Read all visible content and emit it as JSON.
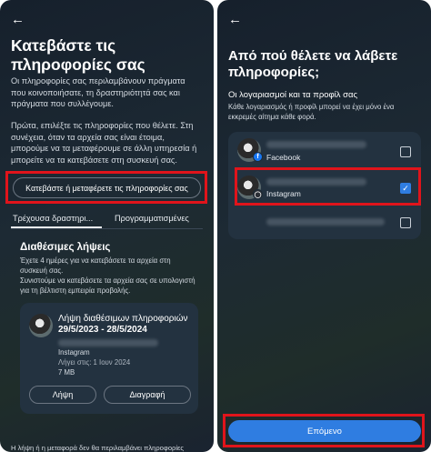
{
  "left": {
    "title": "Κατεβάστε τις πληροφορίες σας",
    "intro": "Οι πληροφορίες σας περιλαμβάνουν πράγματα που κοινοποιήσατε, τη δραστηριότητά σας και πράγματα που συλλέγουμε.",
    "instructions": "Πρώτα, επιλέξτε τις πληροφορίες που θέλετε. Στη συνέχεια, όταν τα αρχεία σας είναι έτοιμα, μπορούμε να τα μεταφέρουμε σε άλλη υπηρεσία ή μπορείτε να τα κατεβάσετε στη συσκευή σας.",
    "download_transfer_button": "Κατεβάστε ή μεταφέρετε τις πληροφορίες σας",
    "tabs": [
      "Τρέχουσα δραστηρι...",
      "Προγραμματισμένες"
    ],
    "available_title": "Διαθέσιμες λήψεις",
    "available_desc": "Έχετε 4 ημέρες για να κατεβάσετε τα αρχεία στη συσκευή σας.\nΣυνιστούμε να κατεβάσετε τα αρχεία σας σε υπολογιστή για τη βέλτιστη εμπειρία προβολής.",
    "card": {
      "title": "Λήψη διαθέσιμων πληροφοριών",
      "date_range": "29/5/2023 - 28/5/2024",
      "platform": "Instagram",
      "expires": "Λήγει στις: 1 Ιουν 2024",
      "size": "7 MB",
      "download_button": "Λήψη",
      "delete_button": "Διαγραφή"
    },
    "footer_partial": "Η λήψη ή η μεταφορά δεν θα περιλαμβάνει πληροφορίες"
  },
  "right": {
    "title": "Από πού θέλετε να λάβετε πληροφορίες;",
    "section_title": "Οι λογαριασμοί και τα προφίλ σας",
    "section_desc": "Κάθε λογαριασμός ή προφίλ μπορεί να έχει μόνο ένα εκκρεμές αίτημα κάθε φορά.",
    "accounts": [
      {
        "platform": "Facebook",
        "icon": "facebook-icon",
        "checked": false
      },
      {
        "platform": "Instagram",
        "icon": "instagram-icon",
        "checked": true
      },
      {
        "platform": "",
        "icon": "",
        "checked": false
      }
    ],
    "next_button": "Επόμενο"
  },
  "colors": {
    "accent": "#2f7de1",
    "highlight": "#e0141b",
    "facebook": "#1877f2"
  }
}
